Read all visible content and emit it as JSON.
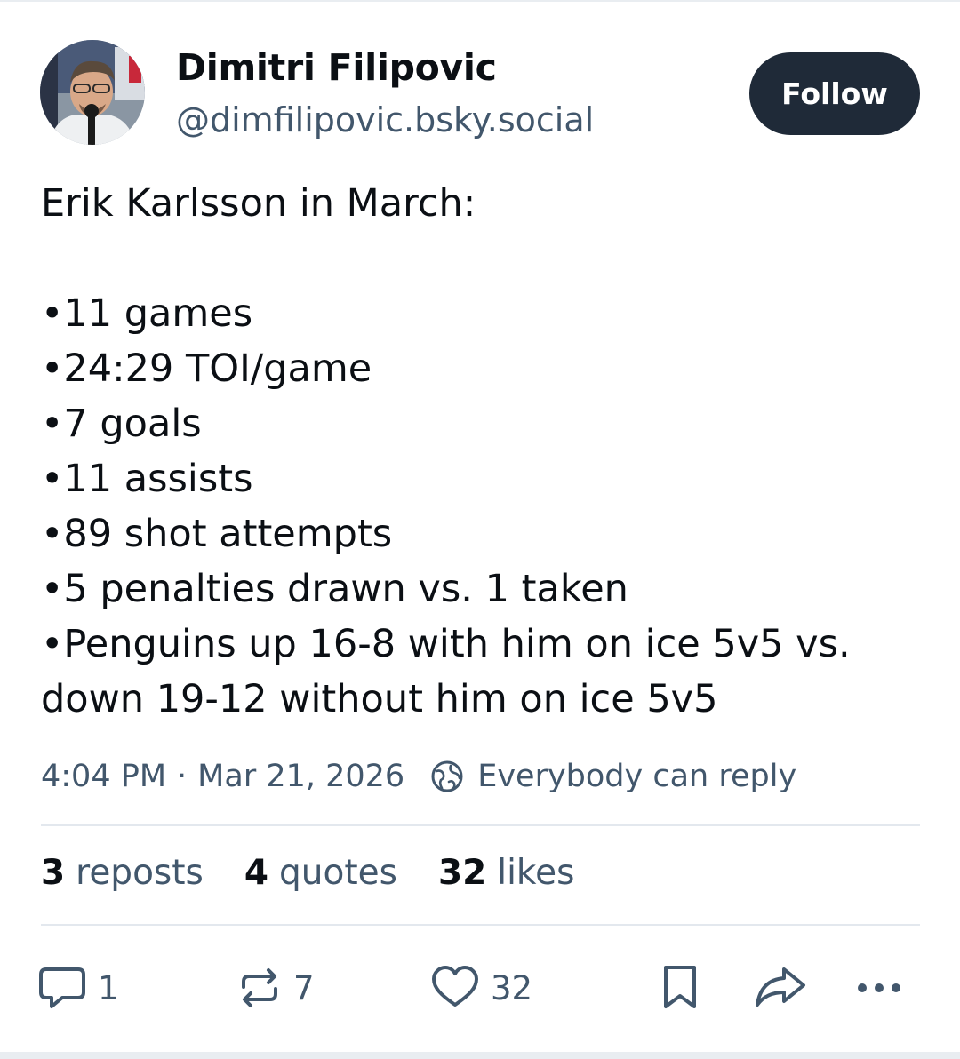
{
  "author": {
    "display_name": "Dimitri Filipovic",
    "handle": "@dimfilipovic.bsky.social",
    "avatar_icon": "avatar-photo"
  },
  "follow_button": {
    "label": "Follow"
  },
  "post": {
    "intro": "Erik Karlsson in March:",
    "bullets": [
      "•11 games",
      "•24:29 TOI/game",
      "•7 goals",
      "•11 assists",
      "•89 shot attempts",
      "•5 penalties drawn vs. 1 taken",
      "•Penguins up 16-8 with him on ice 5v5 vs. down 19-12 without him on ice 5v5"
    ]
  },
  "meta": {
    "time": "4:04 PM",
    "separator": "·",
    "date": "Mar 21, 2026",
    "reply_setting": "Everybody can reply",
    "reply_setting_icon": "globe-icon"
  },
  "stats": {
    "reposts": {
      "count": "3",
      "label": "reposts"
    },
    "quotes": {
      "count": "4",
      "label": "quotes"
    },
    "likes": {
      "count": "32",
      "label": "likes"
    }
  },
  "actions": {
    "reply": {
      "icon": "speech-bubble-icon",
      "count": "1"
    },
    "repost": {
      "icon": "repost-icon",
      "count": "7"
    },
    "like": {
      "icon": "heart-icon",
      "count": "32"
    },
    "save": {
      "icon": "bookmark-icon"
    },
    "share": {
      "icon": "share-arrow-icon"
    },
    "more": {
      "icon": "ellipsis-icon"
    }
  },
  "colors": {
    "text_primary": "#0b0f14",
    "text_secondary": "#42576c",
    "follow_bg": "#1f2a38",
    "divider": "#e3e8ee"
  }
}
